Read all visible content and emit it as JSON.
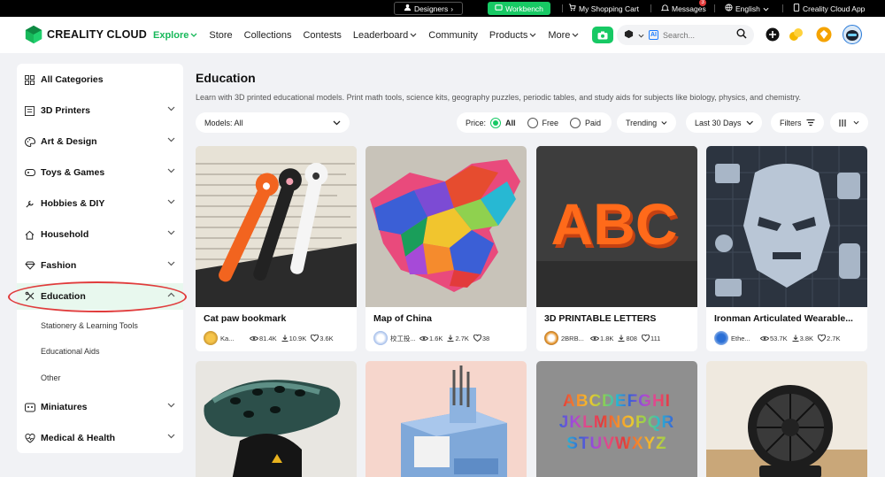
{
  "topbar": {
    "designers": "Designers",
    "workbench": "Workbench",
    "cart": "My Shopping Cart",
    "messages": "Messages",
    "messages_badge": "3",
    "language": "English",
    "app": "Creality Cloud App"
  },
  "nav": {
    "logo": "CREALITY CLOUD",
    "links": [
      "Explore",
      "Store",
      "Collections",
      "Contests",
      "Leaderboard",
      "Community",
      "Products",
      "More"
    ],
    "search_ai": "AI",
    "search_placeholder": "Search..."
  },
  "sidebar": {
    "categories": [
      "All Categories",
      "3D Printers",
      "Art & Design",
      "Toys & Games",
      "Hobbies & DIY",
      "Household",
      "Fashion",
      "Education",
      "Miniatures",
      "Medical & Health"
    ],
    "education_sub": [
      "Stationery & Learning Tools",
      "Educational Aids",
      "Other"
    ]
  },
  "main": {
    "title": "Education",
    "description": "Learn with 3D printed educational models. Print math tools, science kits, geography puzzles, periodic tables, and study aids for subjects like biology, physics, and chemistry.",
    "filters": {
      "models": "Models: All",
      "price_label": "Price:",
      "price_options": [
        "All",
        "Free",
        "Paid"
      ],
      "sort": "Trending",
      "period": "Last 30 Days",
      "filters": "Filters"
    }
  },
  "cards": [
    {
      "title": "Cat paw bookmark",
      "author": "Ka...",
      "views": "81.4K",
      "downloads": "10.9K",
      "likes": "3.6K"
    },
    {
      "title": "Map of China",
      "author": "校工投...",
      "views": "1.6K",
      "downloads": "2.7K",
      "likes": "38"
    },
    {
      "title": "3D PRINTABLE LETTERS",
      "author": "2BRB...",
      "views": "1.8K",
      "downloads": "808",
      "likes": "111"
    },
    {
      "title": "Ironman Articulated Wearable...",
      "author": "Ethe...",
      "views": "53.7K",
      "downloads": "3.8K",
      "likes": "2.7K"
    }
  ],
  "letters_card": {
    "rows": [
      "ABCDEFGHI",
      "JKLMNOPQR",
      "STUVWXYZ"
    ]
  },
  "abc_text": "ABC",
  "colors": {
    "accent": "#17c964",
    "highlight_ring": "#e03c3c"
  }
}
